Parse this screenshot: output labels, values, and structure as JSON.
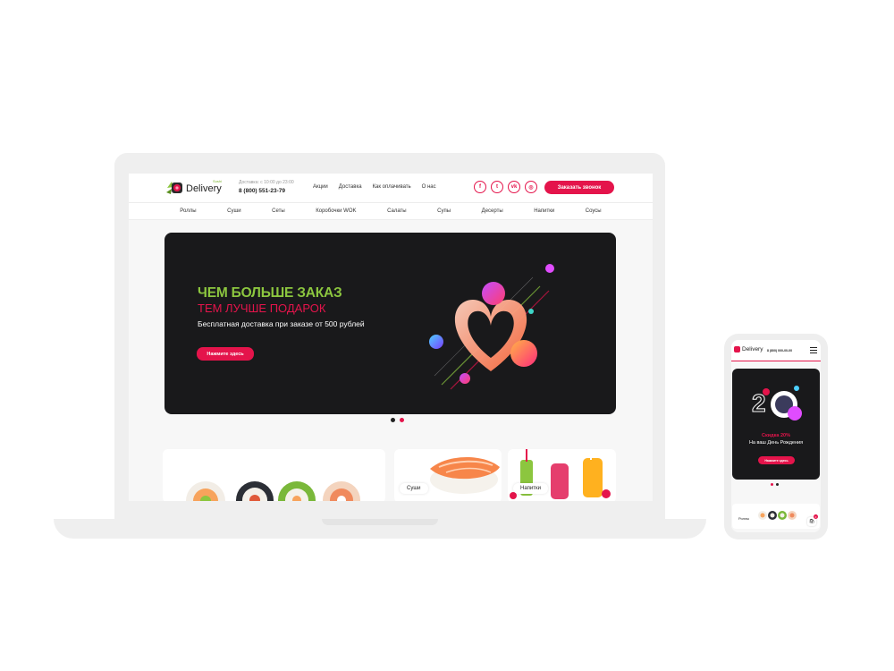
{
  "colors": {
    "accent": "#e4144b",
    "brand_green": "#8cc63f",
    "hero_bg": "#19191b"
  },
  "desktop": {
    "logo": {
      "text": "Delivery",
      "sub": "Sushi"
    },
    "header": {
      "hours": "Доставка: с 10:00 до 23:00",
      "phone": "8 (800) 551-23-79",
      "links": [
        "Акции",
        "Доставка",
        "Как оплачивать",
        "О нас"
      ],
      "socials": [
        {
          "icon": "facebook-icon",
          "glyph": "f"
        },
        {
          "icon": "twitter-icon",
          "glyph": "t"
        },
        {
          "icon": "vk-icon",
          "glyph": "vk"
        },
        {
          "icon": "instagram-icon",
          "glyph": "◎"
        }
      ],
      "call_button": "Заказать звонок"
    },
    "categories": [
      "Роллы",
      "Суши",
      "Сеты",
      "Коробочки WOK",
      "Салаты",
      "Супы",
      "Десерты",
      "Напитки",
      "Соусы"
    ],
    "hero": {
      "title_line1": "ЧЕМ БОЛЬШЕ ЗАКАЗ",
      "title_line2": "ТЕМ ЛУЧШЕ ПОДАРОК",
      "subtitle": "Бесплатная доставка при заказе от 500 рублей",
      "button": "Нажмите здесь"
    },
    "cards": [
      {
        "label": "Суши"
      },
      {
        "label": "Напитки"
      }
    ]
  },
  "mobile": {
    "logo_text": "Delivery",
    "phone": "8 (800) 000-00-00",
    "hero": {
      "title": "Скидка 20%",
      "subtitle": "На ваш День Рождения",
      "button": "Нажмите здесь"
    },
    "card_label": "Роллы",
    "cart_badge": "0"
  }
}
